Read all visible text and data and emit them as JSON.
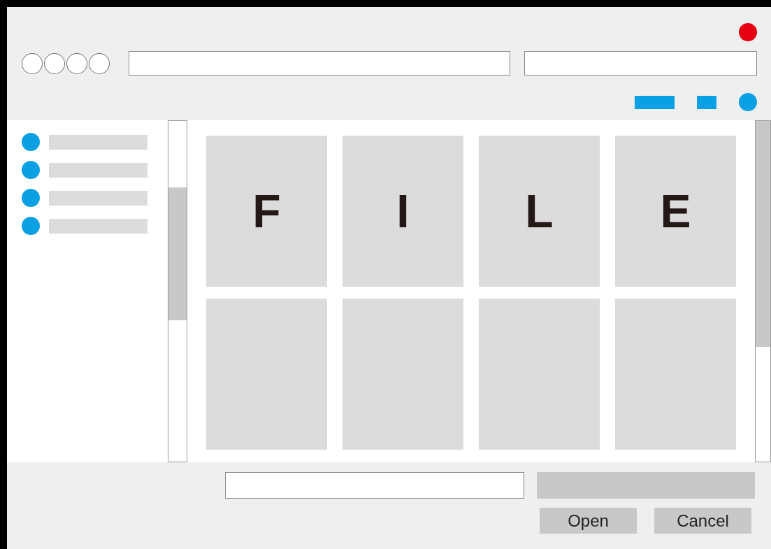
{
  "sidebar": {
    "items": [
      {
        "kind": "entry"
      },
      {
        "kind": "entry"
      },
      {
        "kind": "entry"
      },
      {
        "kind": "entry"
      }
    ]
  },
  "tiles": [
    {
      "kind": "letter",
      "label": "F"
    },
    {
      "kind": "letter",
      "label": "I"
    },
    {
      "kind": "letter",
      "label": "L"
    },
    {
      "kind": "letter",
      "label": "E"
    },
    {
      "kind": "blank"
    },
    {
      "kind": "blank"
    },
    {
      "kind": "blank"
    },
    {
      "kind": "blank"
    }
  ],
  "buttons": [
    {
      "label": "Open"
    },
    {
      "label": "Cancel"
    }
  ]
}
